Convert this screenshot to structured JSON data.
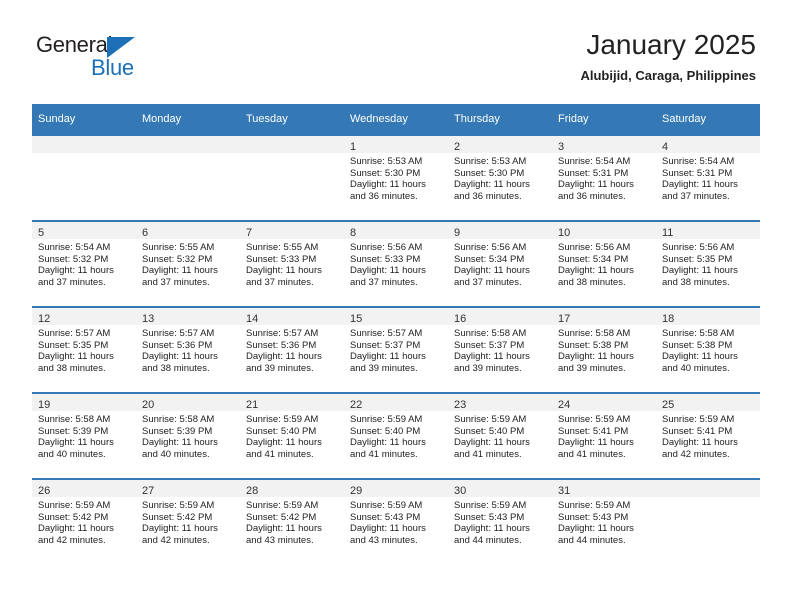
{
  "brand": {
    "name_top": "General",
    "name_bottom": "Blue",
    "accent_color": "#1b70b8",
    "triangle_icon": "triangle-icon"
  },
  "header": {
    "title": "January 2025",
    "subtitle": "Alubijid, Caraga, Philippines"
  },
  "calendar": {
    "header_bg": "#3479b5",
    "row_border": "#3479b5",
    "daynum_bg": "#f2f2f2",
    "weekday_headers": [
      "Sunday",
      "Monday",
      "Tuesday",
      "Wednesday",
      "Thursday",
      "Friday",
      "Saturday"
    ],
    "weeks": [
      [
        {
          "day": "",
          "sunrise": "",
          "sunset": "",
          "daylight_1": "",
          "daylight_2": ""
        },
        {
          "day": "",
          "sunrise": "",
          "sunset": "",
          "daylight_1": "",
          "daylight_2": ""
        },
        {
          "day": "",
          "sunrise": "",
          "sunset": "",
          "daylight_1": "",
          "daylight_2": ""
        },
        {
          "day": "1",
          "sunrise": "Sunrise: 5:53 AM",
          "sunset": "Sunset: 5:30 PM",
          "daylight_1": "Daylight: 11 hours",
          "daylight_2": "and 36 minutes."
        },
        {
          "day": "2",
          "sunrise": "Sunrise: 5:53 AM",
          "sunset": "Sunset: 5:30 PM",
          "daylight_1": "Daylight: 11 hours",
          "daylight_2": "and 36 minutes."
        },
        {
          "day": "3",
          "sunrise": "Sunrise: 5:54 AM",
          "sunset": "Sunset: 5:31 PM",
          "daylight_1": "Daylight: 11 hours",
          "daylight_2": "and 36 minutes."
        },
        {
          "day": "4",
          "sunrise": "Sunrise: 5:54 AM",
          "sunset": "Sunset: 5:31 PM",
          "daylight_1": "Daylight: 11 hours",
          "daylight_2": "and 37 minutes."
        }
      ],
      [
        {
          "day": "5",
          "sunrise": "Sunrise: 5:54 AM",
          "sunset": "Sunset: 5:32 PM",
          "daylight_1": "Daylight: 11 hours",
          "daylight_2": "and 37 minutes."
        },
        {
          "day": "6",
          "sunrise": "Sunrise: 5:55 AM",
          "sunset": "Sunset: 5:32 PM",
          "daylight_1": "Daylight: 11 hours",
          "daylight_2": "and 37 minutes."
        },
        {
          "day": "7",
          "sunrise": "Sunrise: 5:55 AM",
          "sunset": "Sunset: 5:33 PM",
          "daylight_1": "Daylight: 11 hours",
          "daylight_2": "and 37 minutes."
        },
        {
          "day": "8",
          "sunrise": "Sunrise: 5:56 AM",
          "sunset": "Sunset: 5:33 PM",
          "daylight_1": "Daylight: 11 hours",
          "daylight_2": "and 37 minutes."
        },
        {
          "day": "9",
          "sunrise": "Sunrise: 5:56 AM",
          "sunset": "Sunset: 5:34 PM",
          "daylight_1": "Daylight: 11 hours",
          "daylight_2": "and 37 minutes."
        },
        {
          "day": "10",
          "sunrise": "Sunrise: 5:56 AM",
          "sunset": "Sunset: 5:34 PM",
          "daylight_1": "Daylight: 11 hours",
          "daylight_2": "and 38 minutes."
        },
        {
          "day": "11",
          "sunrise": "Sunrise: 5:56 AM",
          "sunset": "Sunset: 5:35 PM",
          "daylight_1": "Daylight: 11 hours",
          "daylight_2": "and 38 minutes."
        }
      ],
      [
        {
          "day": "12",
          "sunrise": "Sunrise: 5:57 AM",
          "sunset": "Sunset: 5:35 PM",
          "daylight_1": "Daylight: 11 hours",
          "daylight_2": "and 38 minutes."
        },
        {
          "day": "13",
          "sunrise": "Sunrise: 5:57 AM",
          "sunset": "Sunset: 5:36 PM",
          "daylight_1": "Daylight: 11 hours",
          "daylight_2": "and 38 minutes."
        },
        {
          "day": "14",
          "sunrise": "Sunrise: 5:57 AM",
          "sunset": "Sunset: 5:36 PM",
          "daylight_1": "Daylight: 11 hours",
          "daylight_2": "and 39 minutes."
        },
        {
          "day": "15",
          "sunrise": "Sunrise: 5:57 AM",
          "sunset": "Sunset: 5:37 PM",
          "daylight_1": "Daylight: 11 hours",
          "daylight_2": "and 39 minutes."
        },
        {
          "day": "16",
          "sunrise": "Sunrise: 5:58 AM",
          "sunset": "Sunset: 5:37 PM",
          "daylight_1": "Daylight: 11 hours",
          "daylight_2": "and 39 minutes."
        },
        {
          "day": "17",
          "sunrise": "Sunrise: 5:58 AM",
          "sunset": "Sunset: 5:38 PM",
          "daylight_1": "Daylight: 11 hours",
          "daylight_2": "and 39 minutes."
        },
        {
          "day": "18",
          "sunrise": "Sunrise: 5:58 AM",
          "sunset": "Sunset: 5:38 PM",
          "daylight_1": "Daylight: 11 hours",
          "daylight_2": "and 40 minutes."
        }
      ],
      [
        {
          "day": "19",
          "sunrise": "Sunrise: 5:58 AM",
          "sunset": "Sunset: 5:39 PM",
          "daylight_1": "Daylight: 11 hours",
          "daylight_2": "and 40 minutes."
        },
        {
          "day": "20",
          "sunrise": "Sunrise: 5:58 AM",
          "sunset": "Sunset: 5:39 PM",
          "daylight_1": "Daylight: 11 hours",
          "daylight_2": "and 40 minutes."
        },
        {
          "day": "21",
          "sunrise": "Sunrise: 5:59 AM",
          "sunset": "Sunset: 5:40 PM",
          "daylight_1": "Daylight: 11 hours",
          "daylight_2": "and 41 minutes."
        },
        {
          "day": "22",
          "sunrise": "Sunrise: 5:59 AM",
          "sunset": "Sunset: 5:40 PM",
          "daylight_1": "Daylight: 11 hours",
          "daylight_2": "and 41 minutes."
        },
        {
          "day": "23",
          "sunrise": "Sunrise: 5:59 AM",
          "sunset": "Sunset: 5:40 PM",
          "daylight_1": "Daylight: 11 hours",
          "daylight_2": "and 41 minutes."
        },
        {
          "day": "24",
          "sunrise": "Sunrise: 5:59 AM",
          "sunset": "Sunset: 5:41 PM",
          "daylight_1": "Daylight: 11 hours",
          "daylight_2": "and 41 minutes."
        },
        {
          "day": "25",
          "sunrise": "Sunrise: 5:59 AM",
          "sunset": "Sunset: 5:41 PM",
          "daylight_1": "Daylight: 11 hours",
          "daylight_2": "and 42 minutes."
        }
      ],
      [
        {
          "day": "26",
          "sunrise": "Sunrise: 5:59 AM",
          "sunset": "Sunset: 5:42 PM",
          "daylight_1": "Daylight: 11 hours",
          "daylight_2": "and 42 minutes."
        },
        {
          "day": "27",
          "sunrise": "Sunrise: 5:59 AM",
          "sunset": "Sunset: 5:42 PM",
          "daylight_1": "Daylight: 11 hours",
          "daylight_2": "and 42 minutes."
        },
        {
          "day": "28",
          "sunrise": "Sunrise: 5:59 AM",
          "sunset": "Sunset: 5:42 PM",
          "daylight_1": "Daylight: 11 hours",
          "daylight_2": "and 43 minutes."
        },
        {
          "day": "29",
          "sunrise": "Sunrise: 5:59 AM",
          "sunset": "Sunset: 5:43 PM",
          "daylight_1": "Daylight: 11 hours",
          "daylight_2": "and 43 minutes."
        },
        {
          "day": "30",
          "sunrise": "Sunrise: 5:59 AM",
          "sunset": "Sunset: 5:43 PM",
          "daylight_1": "Daylight: 11 hours",
          "daylight_2": "and 44 minutes."
        },
        {
          "day": "31",
          "sunrise": "Sunrise: 5:59 AM",
          "sunset": "Sunset: 5:43 PM",
          "daylight_1": "Daylight: 11 hours",
          "daylight_2": "and 44 minutes."
        },
        {
          "day": "",
          "sunrise": "",
          "sunset": "",
          "daylight_1": "",
          "daylight_2": ""
        }
      ]
    ]
  }
}
